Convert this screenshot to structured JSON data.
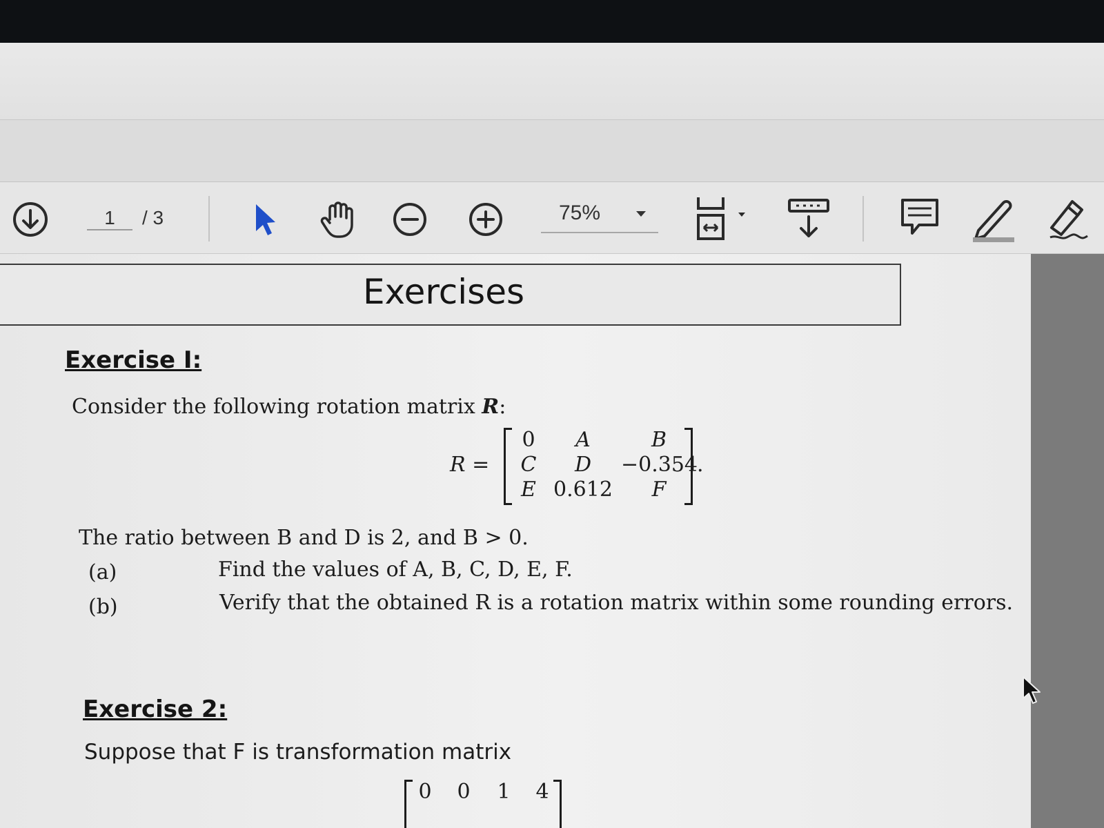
{
  "toolbar": {
    "page_current": "1",
    "page_total": "/ 3",
    "zoom": "75%",
    "icons": [
      "download-icon",
      "select-arrow-icon",
      "hand-tool-icon",
      "zoom-out-icon",
      "zoom-in-icon",
      "fit-page-icon",
      "scroll-mode-icon",
      "comment-icon",
      "highlight-pen-icon",
      "sign-icon"
    ]
  },
  "document": {
    "title": "Exercises",
    "exercise1": {
      "heading": "Exercise I:",
      "intro_text": "Consider the following rotation matrix ",
      "intro_var": "R",
      "intro_end": ":",
      "matrix_label": "R =",
      "matrix": [
        [
          "0",
          "A",
          "B"
        ],
        [
          "C",
          "D",
          "−0.354"
        ],
        [
          "E",
          "0.612",
          "F"
        ]
      ],
      "matrix_end": ".",
      "ratio_text": "The ratio between B and D is 2, and B > 0.",
      "parts": [
        {
          "label": "(a)",
          "text": "Find the values of A, B, C, D, E, F."
        },
        {
          "label": "(b)",
          "text": "Verify that the obtained R is a rotation matrix within some rounding errors."
        }
      ]
    },
    "exercise2": {
      "heading": "Exercise 2:",
      "text": "Suppose that F is transformation matrix",
      "matrix_first_row": [
        "0",
        "0",
        "1",
        "4"
      ]
    }
  }
}
